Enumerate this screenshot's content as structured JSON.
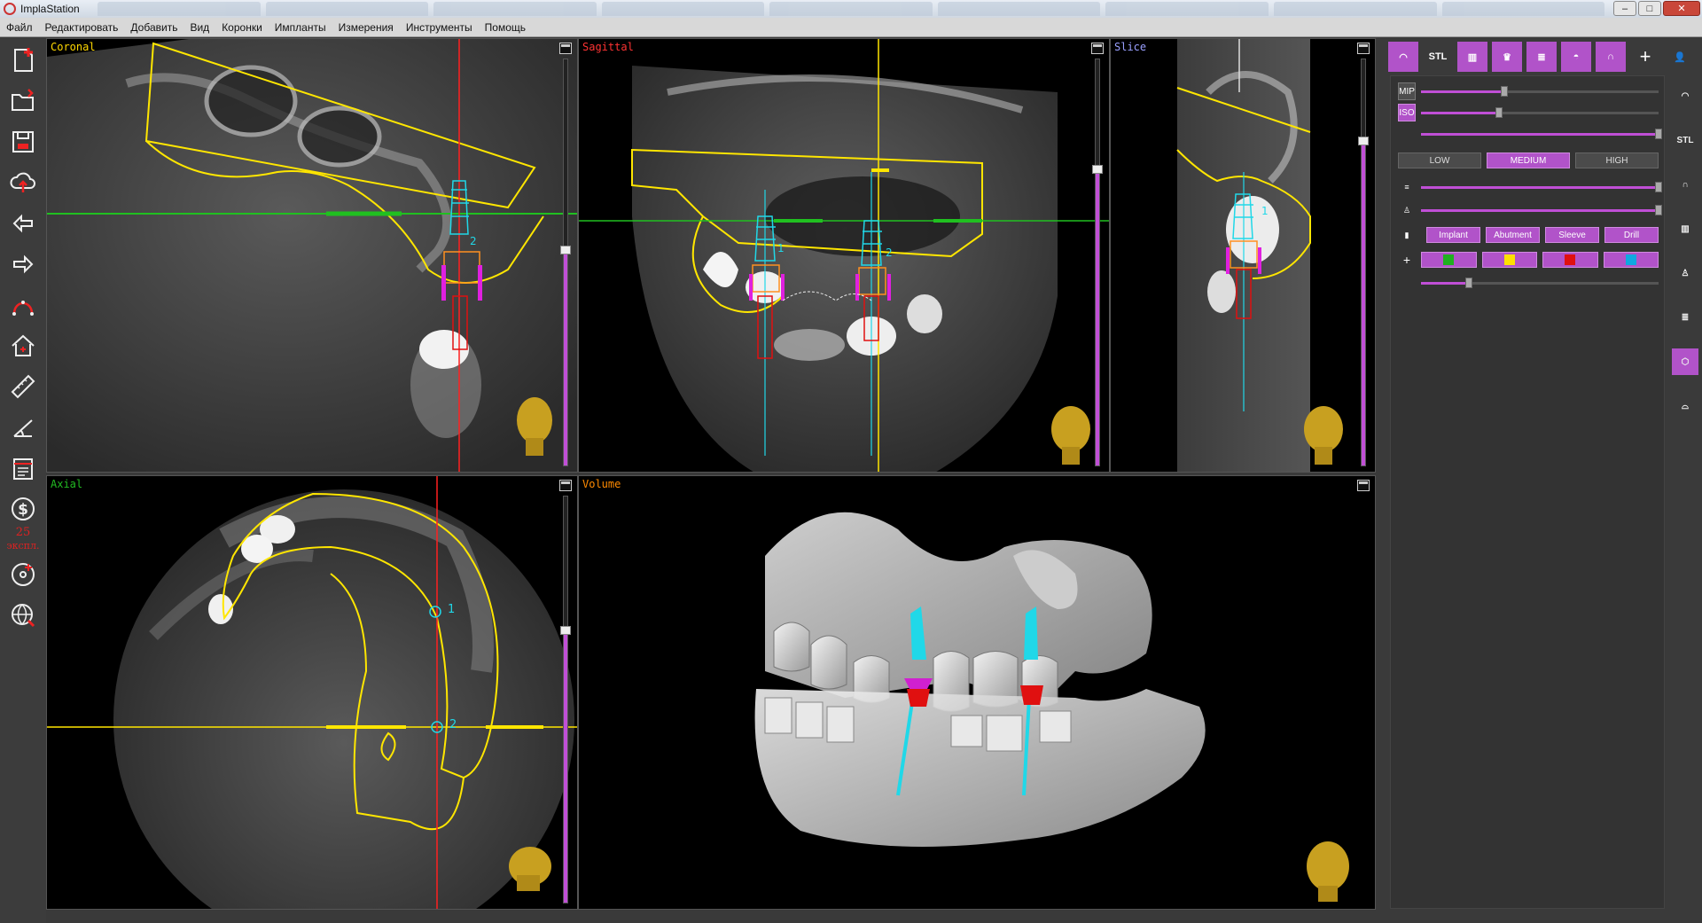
{
  "window": {
    "title": "ImplaStation"
  },
  "menu": [
    "Файл",
    "Редактировать",
    "Добавить",
    "Вид",
    "Коронки",
    "Импланты",
    "Измерения",
    "Инструменты",
    "Помощь"
  ],
  "left_toolbar": {
    "icons": [
      "new-case-icon",
      "open-folder-icon",
      "save-icon",
      "cloud-upload-icon",
      "undo-arrow-icon",
      "redo-arrow-icon",
      "panoramic-curve-icon",
      "home-view-icon",
      "ruler-icon",
      "angle-measure-icon",
      "report-icon",
      "dollar-icon",
      "disc-export-icon",
      "web-share-icon"
    ],
    "credits_value": "25",
    "credits_unit": "экспл."
  },
  "viewports": {
    "coronal": {
      "label": "Coronal",
      "label_color": "#ffd800",
      "slider_level": 0.53
    },
    "sagittal": {
      "label": "Sagittal",
      "label_color": "#ff3333",
      "slider_level": 0.73
    },
    "slice": {
      "label": "Slice",
      "label_color": "#9aa0ff",
      "slider_level": 0.8
    },
    "axial": {
      "label": "Axial",
      "label_color": "#22bb22",
      "slider_level": 0.67
    },
    "volume": {
      "label": "Volume",
      "label_color": "#ff8a00"
    }
  },
  "annotations": {
    "implant_1": "1",
    "implant_2": "2"
  },
  "right_panel": {
    "top_tabs": [
      "jaw-view-icon",
      "stl-icon",
      "dentition-icon",
      "tooth-icon",
      "implant-icon",
      "arch-icon",
      "guide-icon",
      "add-icon",
      "user-settings-icon"
    ],
    "stl_tab_label": "STL",
    "rows": {
      "mip_label": "MIP",
      "mip_level": 0.35,
      "iso_label": "ISO",
      "iso_level": 0.33,
      "opacity_level": 1.0,
      "quality_options": [
        "LOW",
        "MEDIUM",
        "HIGH"
      ],
      "quality_selected": "MEDIUM",
      "stl_opacity_level": 1.0,
      "tooth_opacity_level": 1.0,
      "object_buttons": [
        "Implant",
        "Abutment",
        "Sleeve",
        "Drill"
      ],
      "color_swatches": [
        "#20b020",
        "#ffe000",
        "#e01010",
        "#10a8e0"
      ],
      "size_level": 0.2
    },
    "side_icons": [
      "upper-jaw-icon",
      "stl-list-icon",
      "nerve-canal-icon",
      "teeth-row-icon",
      "single-tooth-icon",
      "implant-side-icon",
      "volume-3d-icon",
      "arch-side-icon"
    ],
    "side_stl_label": "STL"
  },
  "colors": {
    "accent": "#b153c9",
    "yellow_outline": "#ffe600",
    "implant_cyan": "#20d8e8",
    "crosshair_green": "#20c020"
  }
}
